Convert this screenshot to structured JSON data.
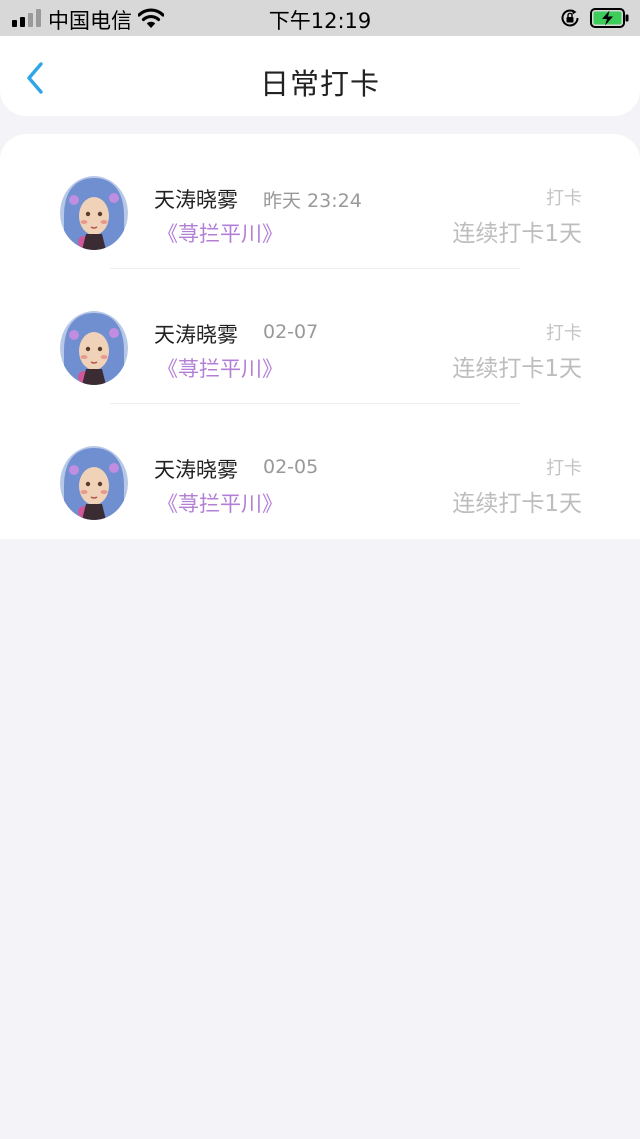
{
  "status_bar": {
    "carrier": "中国电信",
    "time": "下午12:19"
  },
  "header": {
    "title": "日常打卡"
  },
  "colors": {
    "accent_back": "#2ea5e8",
    "book_purple": "#b37fd6",
    "battery_green": "#3ccd5a"
  },
  "items": [
    {
      "user": "天涛晓雾",
      "time": "昨天 23:24",
      "book": "《荨拦平川》",
      "tag": "打卡",
      "streak": "连续打卡1天"
    },
    {
      "user": "天涛晓雾",
      "time": "02-07",
      "book": "《荨拦平川》",
      "tag": "打卡",
      "streak": "连续打卡1天"
    },
    {
      "user": "天涛晓雾",
      "time": "02-05",
      "book": "《荨拦平川》",
      "tag": "打卡",
      "streak": "连续打卡1天"
    }
  ]
}
